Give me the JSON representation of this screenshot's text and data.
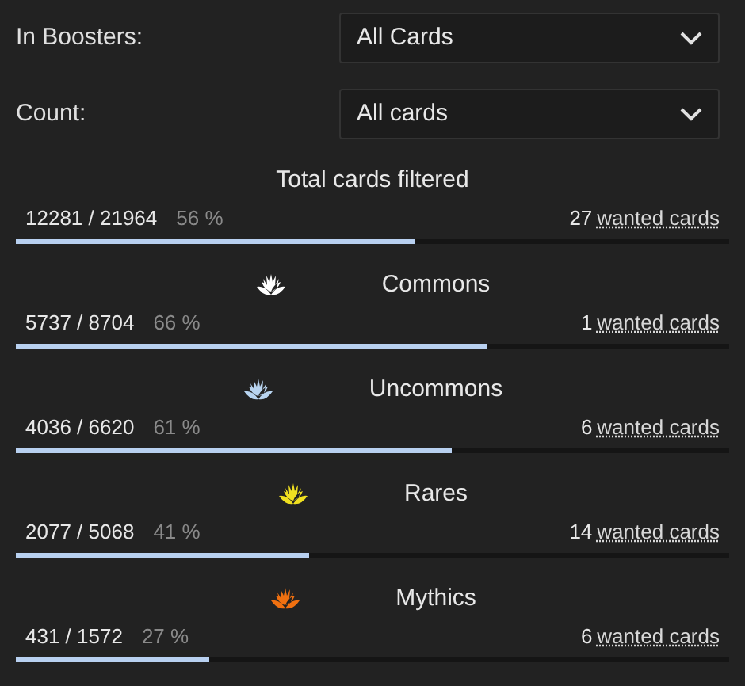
{
  "filters": [
    {
      "label": "In Boosters:",
      "value": "All Cards"
    },
    {
      "label": "Count:",
      "value": "All cards"
    }
  ],
  "sections": [
    {
      "kind": "total",
      "title": "Total cards filtered",
      "count": "12281 / 21964",
      "percent": "56 %",
      "level": 0.56,
      "wanted": "27",
      "wanted_link": "wanted cards"
    },
    {
      "kind": "rarity",
      "color": "#ffffff",
      "title": "Commons",
      "count": "5737 / 8704",
      "percent": "66 %",
      "level": 0.66,
      "wanted": "1",
      "wanted_link": "wanted cards"
    },
    {
      "kind": "rarity",
      "color": "#b8d4f0",
      "title": "Uncommons",
      "count": "4036 / 6620",
      "percent": "61 %",
      "level": 0.61,
      "wanted": "6",
      "wanted_link": "wanted cards"
    },
    {
      "kind": "rarity",
      "color": "#f0e020",
      "title": "Rares",
      "count": "2077 / 5068",
      "percent": "41 %",
      "level": 0.41,
      "wanted": "14",
      "wanted_link": "wanted cards"
    },
    {
      "kind": "rarity",
      "color": "#f07010",
      "title": "Mythics",
      "count": "431 / 1572",
      "percent": "27 %",
      "level": 0.27,
      "wanted": "6",
      "wanted_link": "wanted cards"
    }
  ]
}
